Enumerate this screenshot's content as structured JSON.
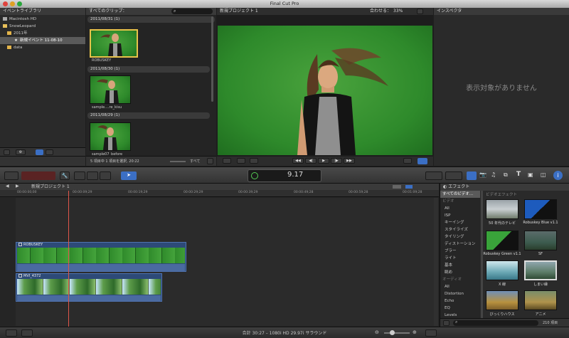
{
  "window": {
    "title": "Final Cut Pro"
  },
  "library": {
    "header": "イベントライブラリ",
    "items": [
      {
        "label": "Macintosh HD"
      },
      {
        "label": "SnowLeopard"
      },
      {
        "label": "2011年"
      },
      {
        "label": "新規イベント 11-08-10"
      },
      {
        "label": "data"
      }
    ]
  },
  "browser": {
    "header": "すべてのクリップ：",
    "groups": [
      {
        "date": "2011/08/31  (1)",
        "clip": "ROBUSKEY"
      },
      {
        "date": "2011/08/30  (1)",
        "clip": "sample....re_kisu"
      },
      {
        "date": "2011/08/29  (1)",
        "clip": "sample07_before"
      }
    ],
    "status": "5 項目中 1 項目を選択, 20:22",
    "filter": "すべて"
  },
  "viewer": {
    "title": "新規プロジェクト 1",
    "fit_label": "合わせる：",
    "zoom": "33%"
  },
  "inspector": {
    "header": "インスペクタ",
    "empty": "表示対象がありません"
  },
  "toolbar": {
    "timecode": "9.17"
  },
  "timeline": {
    "project": "新規プロジェクト 1",
    "ruler": [
      "00:00:00;00",
      "00:00:09;29",
      "00:00:19;29",
      "00:00:29;29",
      "00:00:39;29",
      "00:00:49;28",
      "00:00:59;28",
      "00:01:09;28"
    ],
    "clip1": "ROBUSKEY",
    "clip2": "MVI_4372"
  },
  "effects": {
    "header": "エフェクト",
    "category_header": "すべてのビデオ...",
    "section_title": "ビデオエフェクト",
    "video_group": "ビデオ",
    "audio_group": "オーディオ",
    "video_cats": [
      "All",
      "ISP",
      "キーイング",
      "スタイライズ",
      "タイリング",
      "ディストーション",
      "ブラー",
      "ライト",
      "基本",
      "眺め"
    ],
    "audio_cats": [
      "All",
      "Distortion",
      "Echo",
      "EQ",
      "Levels"
    ],
    "items": [
      {
        "label": "50 年代のテレビ"
      },
      {
        "label": "Robuskey Blue v1.1"
      },
      {
        "label": "Robuskey Green v1.1"
      },
      {
        "label": "SF"
      },
      {
        "label": "X 線"
      },
      {
        "label": "しまい縁"
      },
      {
        "label": "びっくりハウス"
      },
      {
        "label": "アニメ"
      }
    ],
    "count": "210 項目"
  },
  "status": {
    "text": "合計 30:27 – 1080i HD 29.97i サラウンド"
  }
}
